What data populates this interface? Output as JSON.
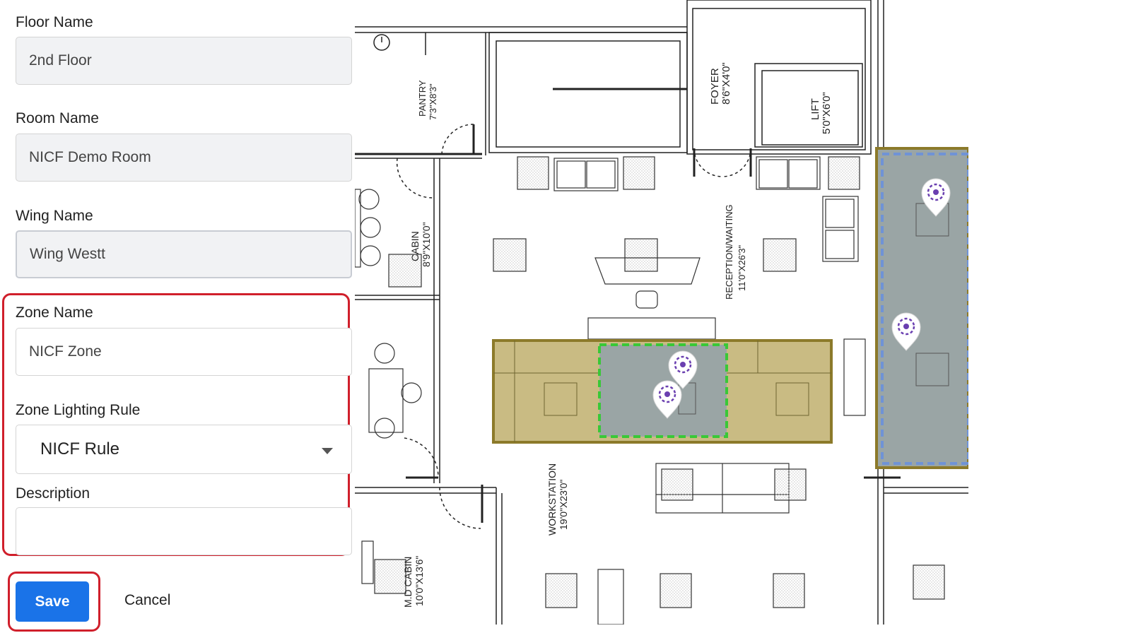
{
  "form": {
    "floor": {
      "label": "Floor Name",
      "value": "2nd Floor"
    },
    "room": {
      "label": "Room Name",
      "value": "NICF Demo Room"
    },
    "wing": {
      "label": "Wing Name",
      "value": "Wing Westt"
    },
    "zone": {
      "label": "Zone Name",
      "value": "NICF Zone"
    },
    "rule": {
      "label": "Zone Lighting Rule",
      "selected": "NICF Rule"
    },
    "description": {
      "label": "Description",
      "value": ""
    },
    "save_label": "Save",
    "cancel_label": "Cancel"
  },
  "floorplan": {
    "rooms": {
      "pantry": "PANTRY",
      "pantry_dim": "7'3\"X8'3\"",
      "foyer": "FOYER",
      "foyer_dim": "8'6\"X4'0\"",
      "lift": "LIFT",
      "lift_dim": "5'0\"X6'0\"",
      "cabin": "CABIN",
      "cabin_dim": "8'9\"X10'0\"",
      "reception": "RECEPTION/WAITING",
      "reception_dim": "11'0\"X26'3\"",
      "workstation": "WORKSTATION",
      "workstation_dim": "19'0\"X23'0\"",
      "md_cabin": "M.D CABIN",
      "md_cabin_dim": "10'0\"X13'6\""
    }
  },
  "colors": {
    "primary_button": "#1a73e8",
    "highlight_red": "#d01f2b",
    "zone_fill_gray": "#9aa5a5",
    "zone_fill_olive": "#c9bb83",
    "zone_border_olive": "#8c7a2a",
    "dashed_green": "#39c837",
    "dashed_blue": "#6f93d6",
    "marker_purple": "#6a3fb0"
  }
}
